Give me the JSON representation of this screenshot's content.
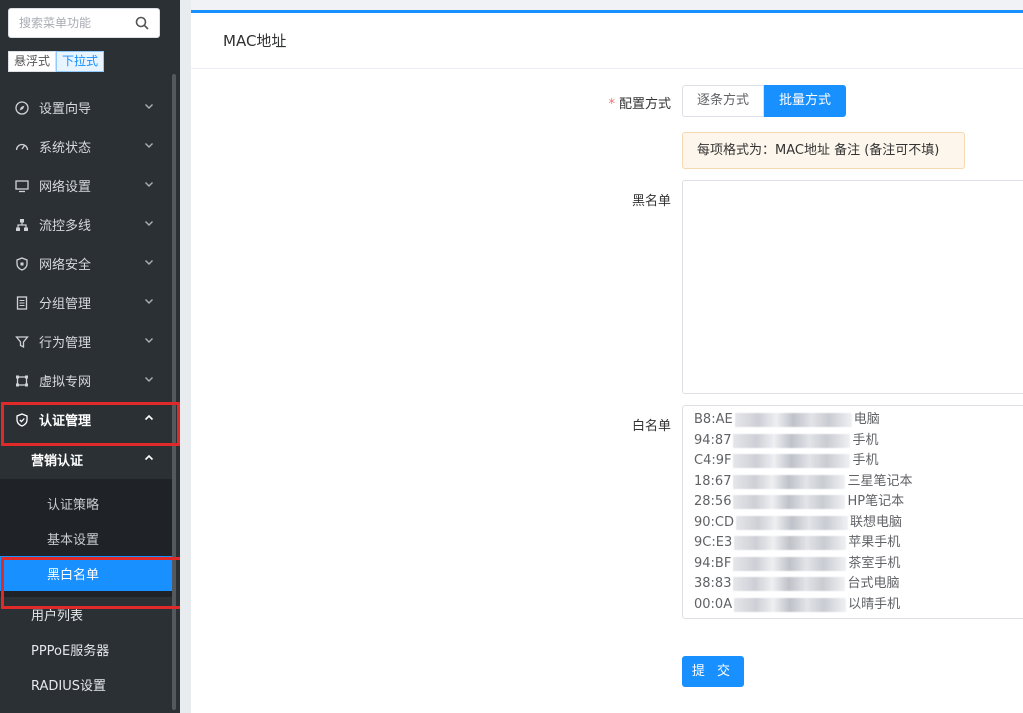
{
  "sidebar": {
    "search_placeholder": "搜索菜单功能",
    "mode_toggle": {
      "float": "悬浮式",
      "dropdown": "下拉式"
    },
    "items": [
      {
        "label": "设置向导"
      },
      {
        "label": "系统状态"
      },
      {
        "label": "网络设置"
      },
      {
        "label": "流控多线"
      },
      {
        "label": "网络安全"
      },
      {
        "label": "分组管理"
      },
      {
        "label": "行为管理"
      },
      {
        "label": "虚拟专网"
      },
      {
        "label": "认证管理"
      }
    ],
    "auth": {
      "group_label": "营销认证",
      "leaves": [
        {
          "label": "认证策略"
        },
        {
          "label": "基本设置"
        },
        {
          "label": "黑白名单"
        }
      ],
      "others": [
        {
          "label": "用户列表"
        },
        {
          "label": "PPPoE服务器"
        },
        {
          "label": "RADIUS设置"
        }
      ]
    }
  },
  "main": {
    "card_title": "MAC地址",
    "config_mode_label": "配置方式",
    "config_modes": {
      "single": "逐条方式",
      "batch": "批量方式"
    },
    "tip": "每项格式为：MAC地址 备注 (备注可不填)",
    "blacklist_label": "黑名单",
    "blacklist_value": "",
    "whitelist_label": "白名单",
    "whitelist": [
      {
        "mac": "B8:AE",
        "note": "电脑"
      },
      {
        "mac": "94:87",
        "note": "手机"
      },
      {
        "mac": "C4:9F",
        "note": "手机"
      },
      {
        "mac": "18:67",
        "note": "三星笔记本"
      },
      {
        "mac": "28:56",
        "note": "HP笔记本"
      },
      {
        "mac": "90:CD",
        "note": "联想电脑"
      },
      {
        "mac": "9C:E3",
        "note": "苹果手机"
      },
      {
        "mac": "94:BF",
        "note": "茶室手机"
      },
      {
        "mac": "38:83",
        "note": "台式电脑"
      },
      {
        "mac": "00:0A",
        "note": "以晴手机"
      }
    ],
    "submit_label": "提 交"
  },
  "colors": {
    "accent": "#1890ff",
    "sidebar_bg": "#2b3035",
    "highlight": "#e02a2a"
  }
}
